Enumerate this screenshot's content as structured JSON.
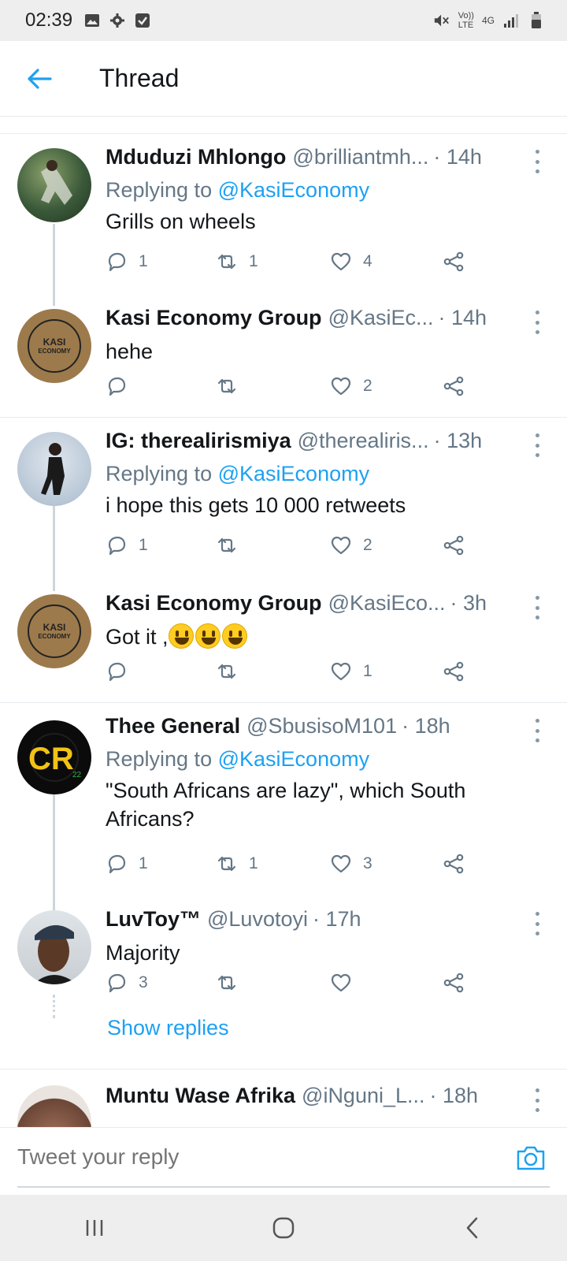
{
  "status_bar": {
    "time": "02:39",
    "network_label": "4G",
    "volte_label": "Vo))",
    "lte_label": "LTE"
  },
  "header": {
    "title": "Thread"
  },
  "tweets": [
    {
      "name": "Mduduzi Mhlongo",
      "handle": "@brilliantmh...",
      "time": "· 14h",
      "replying_prefix": "Replying to",
      "replying_to": "@KasiEconomy",
      "text": "Grills on wheels",
      "reply_count": "1",
      "retweet_count": "1",
      "like_count": "4",
      "avatar_color": "#3b5a3a"
    },
    {
      "name": "Kasi Economy Group",
      "handle": "@KasiEc...",
      "time": "· 14h",
      "text": "hehe",
      "reply_count": "",
      "retweet_count": "",
      "like_count": "2",
      "avatar_text_1": "KASI",
      "avatar_text_2": "ECONOMY"
    },
    {
      "name": "IG: therealirismiya",
      "handle": "@therealiris...",
      "time": "· 13h",
      "replying_prefix": "Replying to",
      "replying_to": "@KasiEconomy",
      "text": "i hope this gets 10 000 retweets",
      "reply_count": "1",
      "retweet_count": "",
      "like_count": "2"
    },
    {
      "name": "Kasi Economy Group",
      "handle": "@KasiEco...",
      "time": "· 3h",
      "text": "Got it ,",
      "reply_count": "",
      "retweet_count": "",
      "like_count": "1",
      "avatar_text_1": "KASI",
      "avatar_text_2": "ECONOMY"
    },
    {
      "name": "Thee General",
      "handle": "@SbusisoM101",
      "time": "· 18h",
      "replying_prefix": "Replying to",
      "replying_to": "@KasiEconomy",
      "text": "\"South Africans are lazy\", which South Africans?",
      "reply_count": "1",
      "retweet_count": "1",
      "like_count": "3",
      "avatar_letters": "CR",
      "avatar_num": "22"
    },
    {
      "name": "LuvToy™",
      "handle": "@Luvotoyi",
      "time": "· 17h",
      "text": "Majority",
      "reply_count": "3",
      "retweet_count": "",
      "like_count": ""
    },
    {
      "name": "Muntu Wase Afrika",
      "handle": "@iNguni_L...",
      "time": "· 18h"
    }
  ],
  "show_replies_label": "Show replies",
  "reply_bar": {
    "placeholder": "Tweet your reply"
  },
  "colors": {
    "accent": "#1da1f2",
    "kasi_avatar": "#9c7a4c"
  }
}
